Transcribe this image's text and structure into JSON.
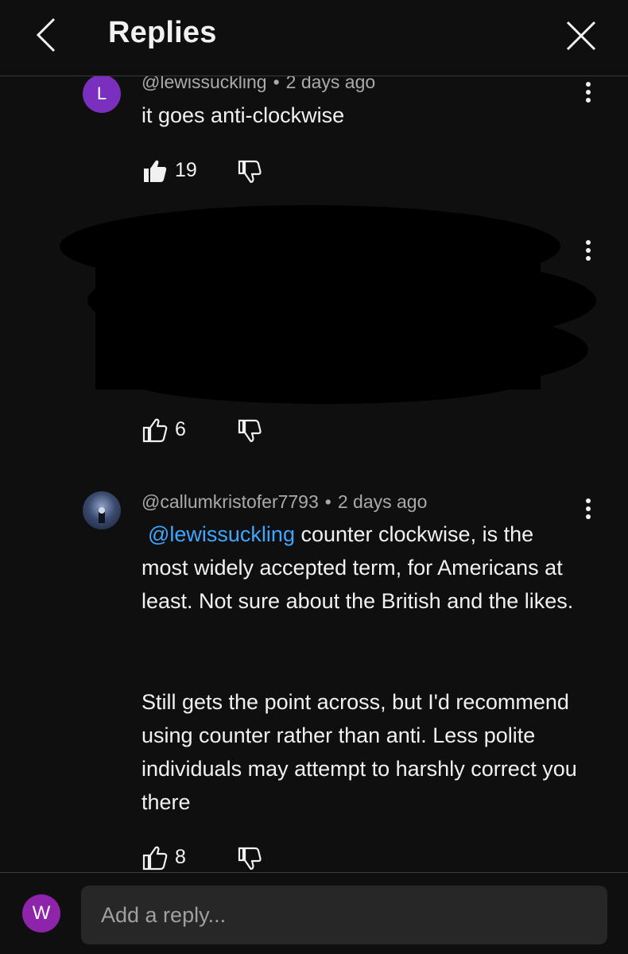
{
  "header": {
    "title": "Replies",
    "back_icon": "chevron-left-icon",
    "close_icon": "close-icon"
  },
  "comments": [
    {
      "avatar_letter": "L",
      "avatar_color": "#7b2fbe",
      "author": "@lewissuckling",
      "time": "2 days ago",
      "text": "it goes anti-clockwise",
      "likes": "19",
      "liked": true
    },
    {
      "redacted": true,
      "likes": "6",
      "liked": false
    },
    {
      "author": "@callumkristofer7793",
      "time": "2 days ago",
      "mention": "@lewissuckling",
      "paragraphs": [
        "counter clockwise, is the most widely accepted term, for Americans at least. Not sure about the British and the likes.",
        "Still gets the point across, but I'd recommend using counter rather than anti. Less polite individuals may attempt to harshly correct you there"
      ],
      "likes": "8",
      "liked": false
    }
  ],
  "reply_bar": {
    "user_letter": "W",
    "user_color": "#8e24aa",
    "placeholder": "Add a reply..."
  },
  "colors": {
    "background": "#0f0f0f",
    "mention": "#3ea6ff",
    "input_bg": "#272727"
  }
}
